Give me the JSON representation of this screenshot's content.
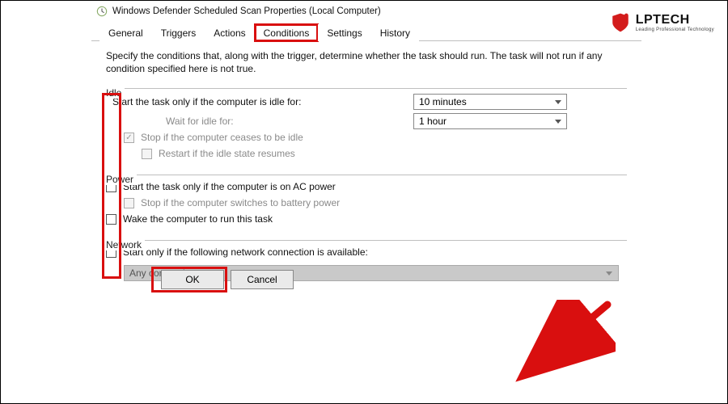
{
  "window": {
    "title": "Windows Defender Scheduled Scan Properties (Local Computer)"
  },
  "tabs": {
    "general": "General",
    "triggers": "Triggers",
    "actions": "Actions",
    "conditions": "Conditions",
    "settings": "Settings",
    "history": "History"
  },
  "intro": "Specify the conditions that, along with the trigger, determine whether the task should run.  The task will not run  if any condition specified here is not true.",
  "groups": {
    "idle": {
      "legend": "Idle",
      "start_only_idle": "Start the task only if the computer is idle for:",
      "wait_for_idle": "Wait for idle for:",
      "stop_not_idle": "Stop if the computer ceases to be idle",
      "restart_idle": "Restart if the idle state resumes",
      "idle_for_value": "10 minutes",
      "wait_value": "1 hour"
    },
    "power": {
      "legend": "Power",
      "ac_power": "Start the task only if the computer is on AC power",
      "stop_battery": "Stop if the computer switches to battery power",
      "wake": "Wake the computer to run this task"
    },
    "network": {
      "legend": "Network",
      "start_net": "Start only if the following network connection is available:",
      "conn_value": "Any connection"
    }
  },
  "buttons": {
    "ok": "OK",
    "cancel": "Cancel"
  },
  "logo": {
    "text": "LPTECH",
    "sub": "Leading Professional Technology"
  }
}
